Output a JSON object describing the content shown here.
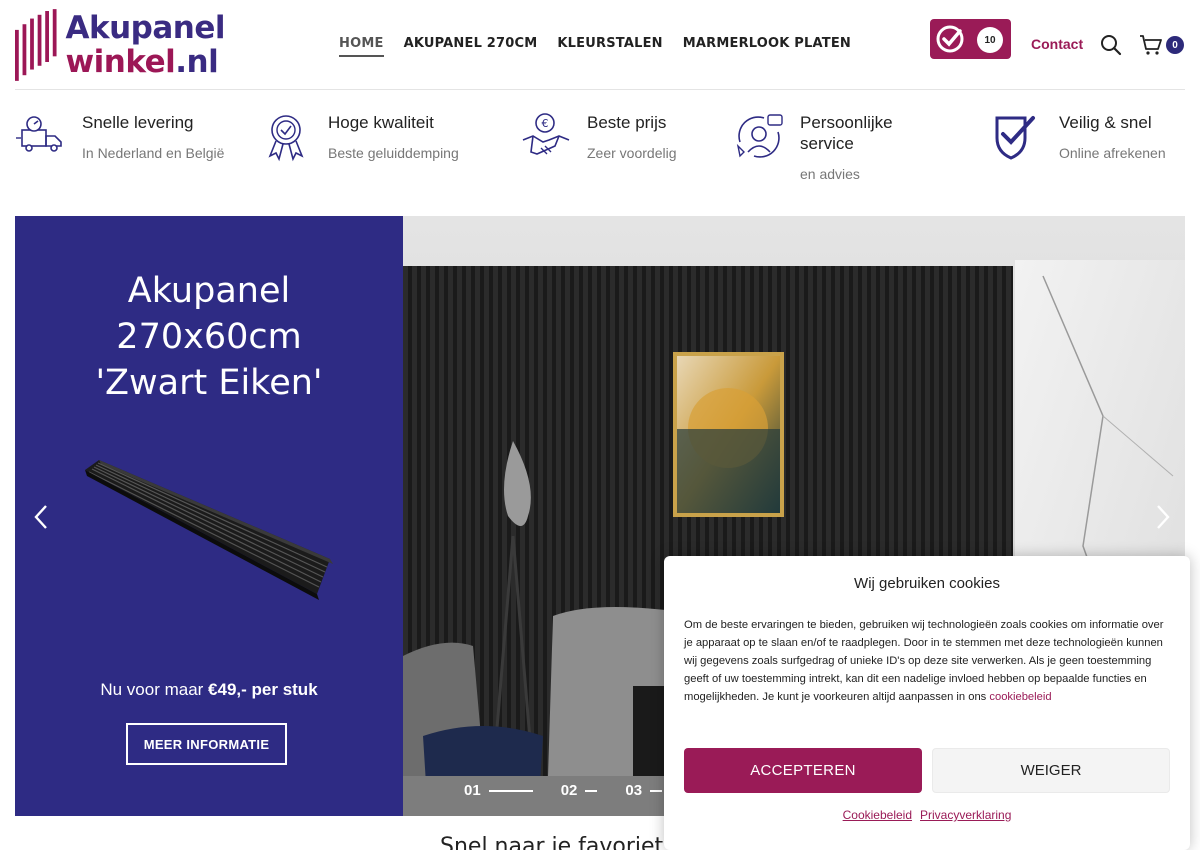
{
  "logo": {
    "line1": "Akupanel",
    "line2": "winkel",
    "dot": ".nl"
  },
  "nav": [
    {
      "label": "HOME",
      "active": true
    },
    {
      "label": "AKUPANEL 270CM"
    },
    {
      "label": "KLEURSTALEN"
    },
    {
      "label": "MARMERLOOK PLATEN"
    }
  ],
  "header": {
    "review_score": "10",
    "contact_label": "Contact",
    "cart_count": "0"
  },
  "usps": [
    {
      "title": "Snelle levering",
      "sub": "In Nederland en België",
      "icon": "delivery-truck-icon"
    },
    {
      "title": "Hoge kwaliteit",
      "sub": "Beste geluiddemping",
      "icon": "award-ribbon-icon"
    },
    {
      "title": "Beste prijs",
      "sub": "Zeer voordelig",
      "icon": "euro-handshake-icon"
    },
    {
      "title": "Persoonlijke service",
      "sub": "en advies",
      "icon": "customer-service-icon"
    },
    {
      "title": "Veilig & snel",
      "sub": "Online afrekenen",
      "icon": "shield-check-icon"
    }
  ],
  "hero": {
    "title_lines": [
      "Akupanel",
      "270x60cm",
      "'Zwart Eiken'"
    ],
    "price_prefix": "Nu voor maar ",
    "price_value": "€49,- per stuk",
    "button_label": "MEER INFORMATIE",
    "slides": [
      "01",
      "02",
      "03"
    ]
  },
  "section_title": "Snel naar je favoriet",
  "cookie": {
    "title": "Wij gebruiken cookies",
    "text": "Om de beste ervaringen te bieden, gebruiken wij technologieën zoals cookies om informatie over je apparaat op te slaan en/of te raadplegen. Door in te stemmen met deze technologieën kunnen wij gegevens zoals surfgedrag of unieke ID's op deze site verwerken. Als je geen toestemming geeft of uw toestemming intrekt, kan dit een nadelige invloed hebben op bepaalde functies en mogelijkheden. Je kunt je voorkeuren altijd aanpassen in ons ",
    "text_link": "cookiebeleid",
    "accept_label": "ACCEPTEREN",
    "deny_label": "WEIGER",
    "link_policy": "Cookiebeleid",
    "link_privacy": "Privacyverklaring"
  },
  "colors": {
    "brand_purple": "#2e2b84",
    "brand_magenta": "#9a1b57"
  }
}
